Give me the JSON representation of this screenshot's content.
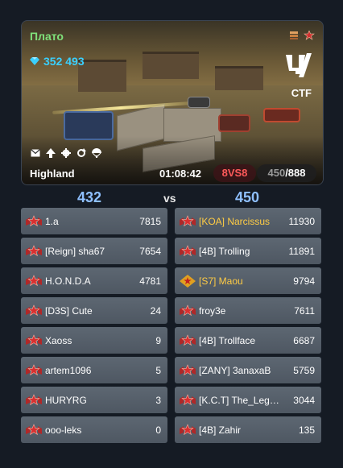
{
  "battle": {
    "server": "Плато",
    "crystals": "352 493",
    "mode": "CTF",
    "map_name": "Highland",
    "timer": "01:08:42",
    "format": "8VS8",
    "players_current": "450",
    "players_max": "/888"
  },
  "scores": {
    "left": "432",
    "vs": "vs",
    "right": "450"
  },
  "teams": {
    "left": [
      {
        "name": "1.a",
        "points": "7815",
        "rank": "rank-insignia-icon",
        "highlight": false
      },
      {
        "name": "[Reign] sha67",
        "points": "7654",
        "rank": "rank-insignia-icon",
        "highlight": false
      },
      {
        "name": "H.O.N.D.A",
        "points": "4781",
        "rank": "rank-insignia-icon",
        "highlight": false
      },
      {
        "name": "[D3S] Cute",
        "points": "24",
        "rank": "rank-insignia-icon",
        "highlight": false
      },
      {
        "name": "Xaoss",
        "points": "9",
        "rank": "rank-insignia-icon",
        "highlight": false
      },
      {
        "name": "artem1096",
        "points": "5",
        "rank": "rank-insignia-icon",
        "highlight": false
      },
      {
        "name": "HURYRG",
        "points": "3",
        "rank": "rank-insignia-icon",
        "highlight": false
      },
      {
        "name": "ooo-leks",
        "points": "0",
        "rank": "rank-insignia-icon",
        "highlight": false
      }
    ],
    "right": [
      {
        "name": "[KOA] Narcissus",
        "points": "11930",
        "rank": "rank-insignia-icon",
        "highlight": true
      },
      {
        "name": "[4B] Trolling",
        "points": "11891",
        "rank": "rank-insignia-icon",
        "highlight": false
      },
      {
        "name": "[S7] Maou",
        "points": "9794",
        "rank": "legend-rank-icon",
        "highlight": true
      },
      {
        "name": "froy3e",
        "points": "7611",
        "rank": "rank-insignia-icon",
        "highlight": false
      },
      {
        "name": "[4B] Trollface",
        "points": "6687",
        "rank": "rank-insignia-icon",
        "highlight": false
      },
      {
        "name": "[ZANY] 3anaxaB",
        "points": "5759",
        "rank": "rank-insignia-icon",
        "highlight": false
      },
      {
        "name": "[K.C.T] The_Legend",
        "points": "3044",
        "rank": "rank-insignia-icon",
        "highlight": false
      },
      {
        "name": "[4B] Zahir",
        "points": "135",
        "rank": "rank-insignia-icon",
        "highlight": false
      }
    ]
  },
  "icons": {
    "crystal": "crystal-icon",
    "status": [
      "mail-icon",
      "upgrade-arrow-icon",
      "gear-icon",
      "refresh-icon",
      "parachute-icon"
    ]
  },
  "colors": {
    "server": "#7fe07a",
    "crystals": "#3ad0ff",
    "score": "#8fc0ff",
    "format": "#ff5a5a",
    "clan_highlight": "#ffcc44",
    "row_bg": "#56606b"
  }
}
